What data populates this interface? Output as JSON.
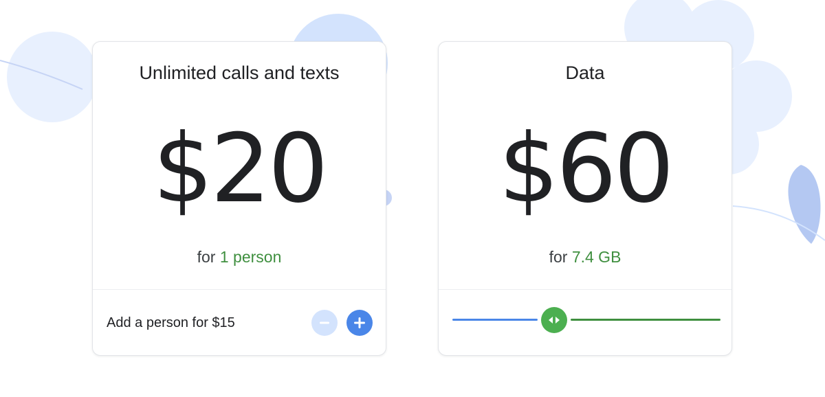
{
  "colors": {
    "accent_green": "#3f8f3f",
    "accent_blue": "#4a86e8",
    "light_blue": "#d3e3fd",
    "decor_blue": "#e8f0fe"
  },
  "calls_card": {
    "title": "Unlimited calls and texts",
    "price": "$20",
    "sub_prefix": "for",
    "sub_value": "1 person",
    "add_label": "Add a person for $15",
    "minus_icon": "minus-icon",
    "plus_icon": "plus-icon"
  },
  "data_card": {
    "title": "Data",
    "price": "$60",
    "sub_prefix": "for",
    "sub_value": "7.4 GB",
    "slider_fraction": 0.38,
    "slider_icon": "left-right-arrows-icon"
  }
}
